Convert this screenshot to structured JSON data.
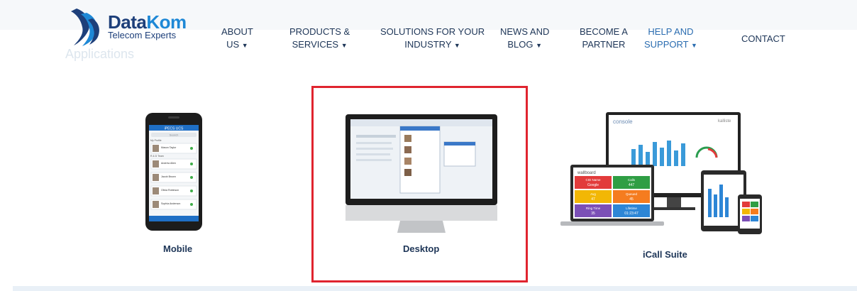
{
  "logo": {
    "brand_left": "Data",
    "brand_right": "Kom",
    "tagline": "Telecom Experts"
  },
  "ghost_heading": "Applications",
  "nav": [
    {
      "line1": "ABOUT",
      "line2": "US"
    },
    {
      "line1": "PRODUCTS &",
      "line2": "SERVICES"
    },
    {
      "line1": "SOLUTIONS FOR YOUR",
      "line2": "INDUSTRY"
    },
    {
      "line1": "NEWS AND",
      "line2": "BLOG"
    },
    {
      "line1": "BECOME A",
      "line2": "PARTNER"
    },
    {
      "line1": "HELP AND",
      "line2": "SUPPORT"
    },
    {
      "line1": "CONTACT",
      "line2": ""
    }
  ],
  "apps": [
    {
      "label": "Mobile",
      "icon": "smartphone-icon"
    },
    {
      "label": "Desktop",
      "icon": "desktop-monitor-icon"
    },
    {
      "label": "iCall Suite",
      "icon": "multi-device-icon"
    }
  ],
  "phone_screen": {
    "header": "iPECS UCS",
    "search": "Search",
    "section1": "My Profile",
    "section2": "R & D Team",
    "contacts": [
      "Mason Taylor",
      "Andrew Allen",
      "Jacob Brown",
      "Olivia Robinson",
      "Sophia Anderson"
    ]
  },
  "suite_tiles": [
    {
      "label": "CID Name",
      "value": "Google",
      "color": "#e23b3b"
    },
    {
      "label": "Calls",
      "value": "447",
      "color": "#2f9e44"
    },
    {
      "label": "Avg",
      "value": "47",
      "color": "#f2b705"
    },
    {
      "label": "Queued",
      "value": "45",
      "color": "#f57c1f"
    },
    {
      "label": "Ring Time",
      "value": "35",
      "color": "#7b4fb6"
    },
    {
      "label": "Lifetime",
      "value": "01:23:47",
      "color": "#2d86d6"
    }
  ],
  "suite_text": {
    "console": "console",
    "wallboard": "wallboard",
    "brand": "kalliste"
  },
  "colors": {
    "nav_text": "#1d3557",
    "nav_active": "#2a6cb0",
    "highlight": "#e0242f",
    "logo_dark": "#1d3f7a",
    "logo_light": "#1e88d6"
  }
}
